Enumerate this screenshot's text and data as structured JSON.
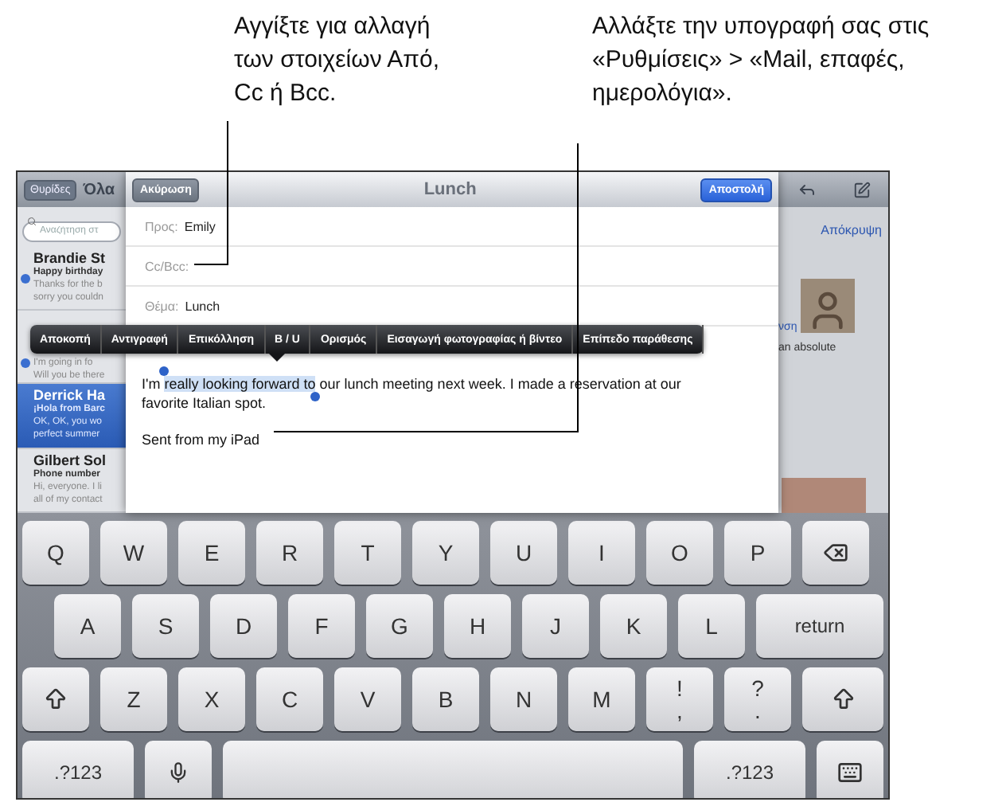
{
  "callouts": [
    {
      "text": "Αγγίξτε για αλλαγή των στοιχείων Από, Cc ή Bcc."
    },
    {
      "text": "Αλλάξτε την υπογραφή σας στις «Ρυθμίσεις» > «Mail, επαφές, ημερολόγια»."
    }
  ],
  "mail_list": {
    "back_button": "Θυρίδες",
    "title": "Όλα",
    "search": {
      "placeholder": "Αναζήτηση στ"
    },
    "items": [
      {
        "sender": "Brandie St",
        "lines": [
          "Happy birthday",
          "Thanks for the b",
          "sorry you couldn"
        ],
        "unread": true,
        "selected": false
      },
      {
        "lines": [
          "I'm going in fo",
          "Will you be there"
        ],
        "unread": true,
        "selected": false
      },
      {
        "sender": "Derrick Ha",
        "lines": [
          "¡Hola from Barc",
          "OK, OK, you wo",
          "perfect summer"
        ],
        "unread": false,
        "selected": true
      },
      {
        "sender": "Gilbert Sol",
        "lines": [
          "Phone number",
          "Hi, everyone. I li",
          "all of my contact"
        ],
        "unread": false,
        "selected": false
      }
    ]
  },
  "compose": {
    "cancel": "Ακύρωση",
    "title": "Lunch",
    "send": "Αποστολή",
    "fields": [
      {
        "label": "Προς:",
        "value": "Emily"
      },
      {
        "label": "Cc/Bcc:"
      },
      {
        "label": "Θέμα:",
        "value": "Lunch"
      }
    ],
    "body": {
      "before": "I'm ",
      "selected": "really looking forward to",
      "after": " our lunch meeting next week. I made a reservation at our favorite Italian spot."
    },
    "signature": "Sent from my iPad"
  },
  "edit_menu": [
    "Αποκοπή",
    "Αντιγραφή",
    "Επικόλληση",
    "B / U",
    "Ορισμός",
    "Εισαγωγή φωτογραφίας ή βίντεο",
    "Επίπεδο παράθεσης"
  ],
  "message_pane": {
    "hide_link": "Απόκρυψη",
    "snippet_1": "νση",
    "snippet_2": "an absolute"
  },
  "keyboard": {
    "rows": [
      [
        {
          "kind": "char",
          "label": "Q"
        },
        {
          "kind": "char",
          "label": "W"
        },
        {
          "kind": "char",
          "label": "E"
        },
        {
          "kind": "char",
          "label": "R"
        },
        {
          "kind": "char",
          "label": "T"
        },
        {
          "kind": "char",
          "label": "Y"
        },
        {
          "kind": "char",
          "label": "U"
        },
        {
          "kind": "char",
          "label": "I"
        },
        {
          "kind": "char",
          "label": "O"
        },
        {
          "kind": "char",
          "label": "P"
        },
        {
          "kind": "delete"
        }
      ],
      [
        {
          "kind": "char",
          "label": "A"
        },
        {
          "kind": "char",
          "label": "S"
        },
        {
          "kind": "char",
          "label": "D"
        },
        {
          "kind": "char",
          "label": "F"
        },
        {
          "kind": "char",
          "label": "G"
        },
        {
          "kind": "char",
          "label": "H"
        },
        {
          "kind": "char",
          "label": "J"
        },
        {
          "kind": "char",
          "label": "K"
        },
        {
          "kind": "char",
          "label": "L"
        },
        {
          "kind": "return",
          "label": "return"
        }
      ],
      [
        {
          "kind": "shift"
        },
        {
          "kind": "char",
          "label": "Z"
        },
        {
          "kind": "char",
          "label": "X"
        },
        {
          "kind": "char",
          "label": "C"
        },
        {
          "kind": "char",
          "label": "V"
        },
        {
          "kind": "char",
          "label": "B"
        },
        {
          "kind": "char",
          "label": "N"
        },
        {
          "kind": "char",
          "label": "M"
        },
        {
          "kind": "dual",
          "top": "!",
          "bottom": ","
        },
        {
          "kind": "dual",
          "top": "?",
          "bottom": "."
        },
        {
          "kind": "shift"
        }
      ]
    ],
    "bottom_row": [
      {
        "kind": "mode",
        "label": ".?123"
      },
      {
        "kind": "mic"
      },
      {
        "kind": "space"
      },
      {
        "kind": "mode",
        "label": ".?123"
      },
      {
        "kind": "hide"
      }
    ]
  }
}
